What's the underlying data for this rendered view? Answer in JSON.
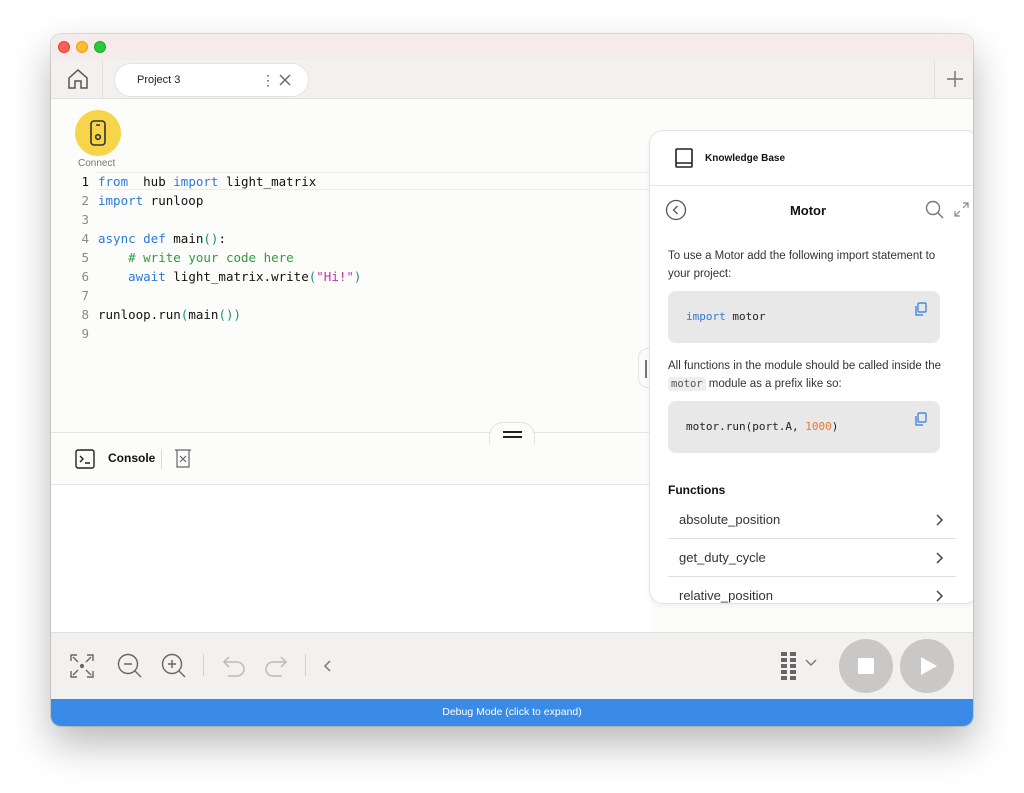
{
  "tab": {
    "label": "Project 3",
    "more": "⋮"
  },
  "connect": {
    "label": "Connect"
  },
  "editor": {
    "active_line": 1,
    "lines": [
      {
        "n": "1",
        "parts": [
          [
            "kw",
            "from"
          ],
          [
            "",
            "  hub "
          ],
          [
            "kw",
            "import"
          ],
          [
            "",
            " light_matrix"
          ]
        ]
      },
      {
        "n": "2",
        "parts": [
          [
            "kw",
            "import"
          ],
          [
            "",
            " runloop"
          ]
        ]
      },
      {
        "n": "3",
        "parts": []
      },
      {
        "n": "4",
        "parts": [
          [
            "kw",
            "async"
          ],
          [
            "",
            " "
          ],
          [
            "kw",
            "def"
          ],
          [
            "",
            " main"
          ],
          [
            "pn",
            "()"
          ],
          [
            "",
            ":"
          ]
        ]
      },
      {
        "n": "5",
        "parts": [
          [
            "",
            "    "
          ],
          [
            "cm",
            "# write your code here"
          ]
        ]
      },
      {
        "n": "6",
        "parts": [
          [
            "",
            "    "
          ],
          [
            "kw",
            "await"
          ],
          [
            "",
            " light_matrix.write"
          ],
          [
            "pn",
            "("
          ],
          [
            "st",
            "\"Hi!\""
          ],
          [
            "pn",
            ")"
          ]
        ]
      },
      {
        "n": "7",
        "parts": []
      },
      {
        "n": "8",
        "parts": [
          [
            "",
            "runloop.run"
          ],
          [
            "pn",
            "("
          ],
          [
            "",
            "main"
          ],
          [
            "pn",
            "())"
          ]
        ]
      },
      {
        "n": "9",
        "parts": []
      }
    ]
  },
  "console": {
    "label": "Console"
  },
  "knowledge_base": {
    "title": "Knowledge Base",
    "heading": "Motor",
    "intro": "To use a Motor add the following import statement to your project:",
    "code1": {
      "kw": "import",
      "rest": " motor"
    },
    "para2_pre": "All functions in the module should be called inside the ",
    "para2_code": "motor",
    "para2_post": " module as a prefix like so:",
    "code2": {
      "pre": "motor.run(port.A, ",
      "num": "1000",
      "post": ")"
    },
    "functions_heading": "Functions",
    "functions": [
      "absolute_position",
      "get_duty_cycle",
      "relative_position"
    ]
  },
  "debug": {
    "label": "Debug Mode (click to expand)"
  },
  "colors": {
    "accent": "#3a8ae8",
    "connect": "#f7d54a",
    "keyword": "#2c7ad6",
    "comment": "#2f9c3a",
    "string": "#c832a8"
  }
}
